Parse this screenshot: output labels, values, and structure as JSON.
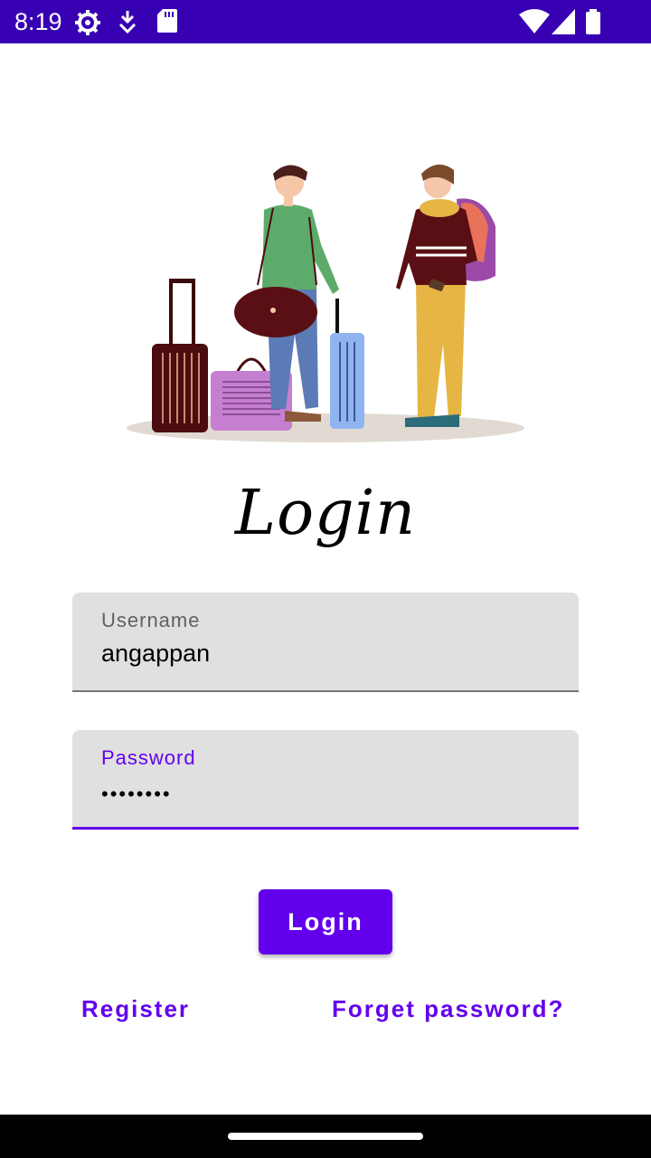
{
  "status_bar": {
    "time": "8:19",
    "icons": [
      "settings-icon",
      "download-icon",
      "sd-card-icon",
      "wifi-icon",
      "signal-icon",
      "battery-icon"
    ],
    "background": "#3700b3"
  },
  "illustration": {
    "description_icon": "travelers-with-luggage-illustration"
  },
  "title": "Login",
  "username": {
    "label": "Username",
    "value": "angappan"
  },
  "password": {
    "label": "Password",
    "value": "••••••••"
  },
  "login_button": "Login",
  "register_link": "Register",
  "forget_link": "Forget password?",
  "colors": {
    "primary": "#6200ee",
    "primary_dark": "#3700b3",
    "field_bg": "#e0e0e0"
  }
}
